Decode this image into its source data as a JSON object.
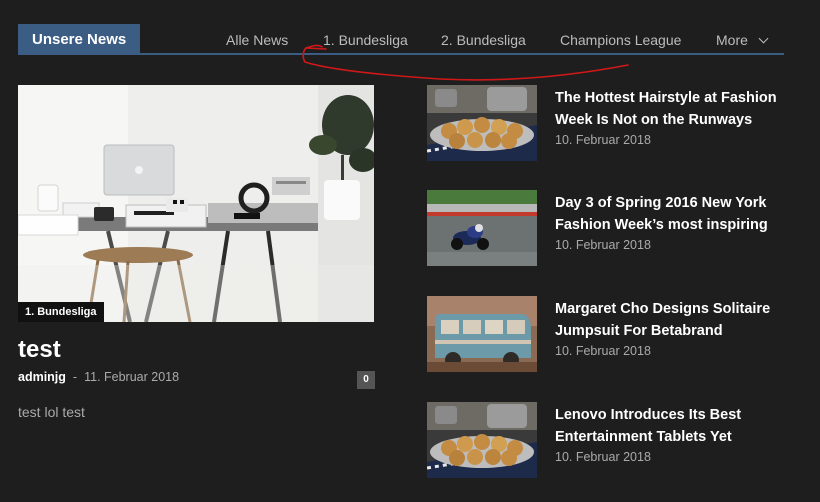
{
  "header": {
    "title": "Unsere News",
    "nav": [
      {
        "label": "Alle News"
      },
      {
        "label": "1. Bundesliga"
      },
      {
        "label": "2. Bundesliga"
      },
      {
        "label": "Champions League"
      },
      {
        "label": "More"
      }
    ]
  },
  "feature": {
    "category": "1. Bundesliga",
    "title": "test",
    "author": "adminjg",
    "separator": "-",
    "date": "11. Februar 2018",
    "comments": "0",
    "excerpt": "test lol test"
  },
  "articles": [
    {
      "title": "The Hottest Hairstyle at Fashion Week Is Not on the Runways",
      "date": "10. Februar 2018",
      "thumb": "bread-rolls"
    },
    {
      "title": "Day 3 of Spring 2016 New York Fashion Week’s most inspiring",
      "date": "10. Februar 2018",
      "thumb": "motorcycle-race"
    },
    {
      "title": "Margaret Cho Designs Solitaire Jumpsuit For Betabrand",
      "date": "10. Februar 2018",
      "thumb": "vintage-van"
    },
    {
      "title": "Lenovo Introduces Its Best Entertainment Tablets Yet",
      "date": "10. Februar 2018",
      "thumb": "bread-rolls"
    }
  ],
  "colors": {
    "accent": "#3b5d84",
    "background": "#1e1e1e",
    "annotation": "#d01818"
  }
}
